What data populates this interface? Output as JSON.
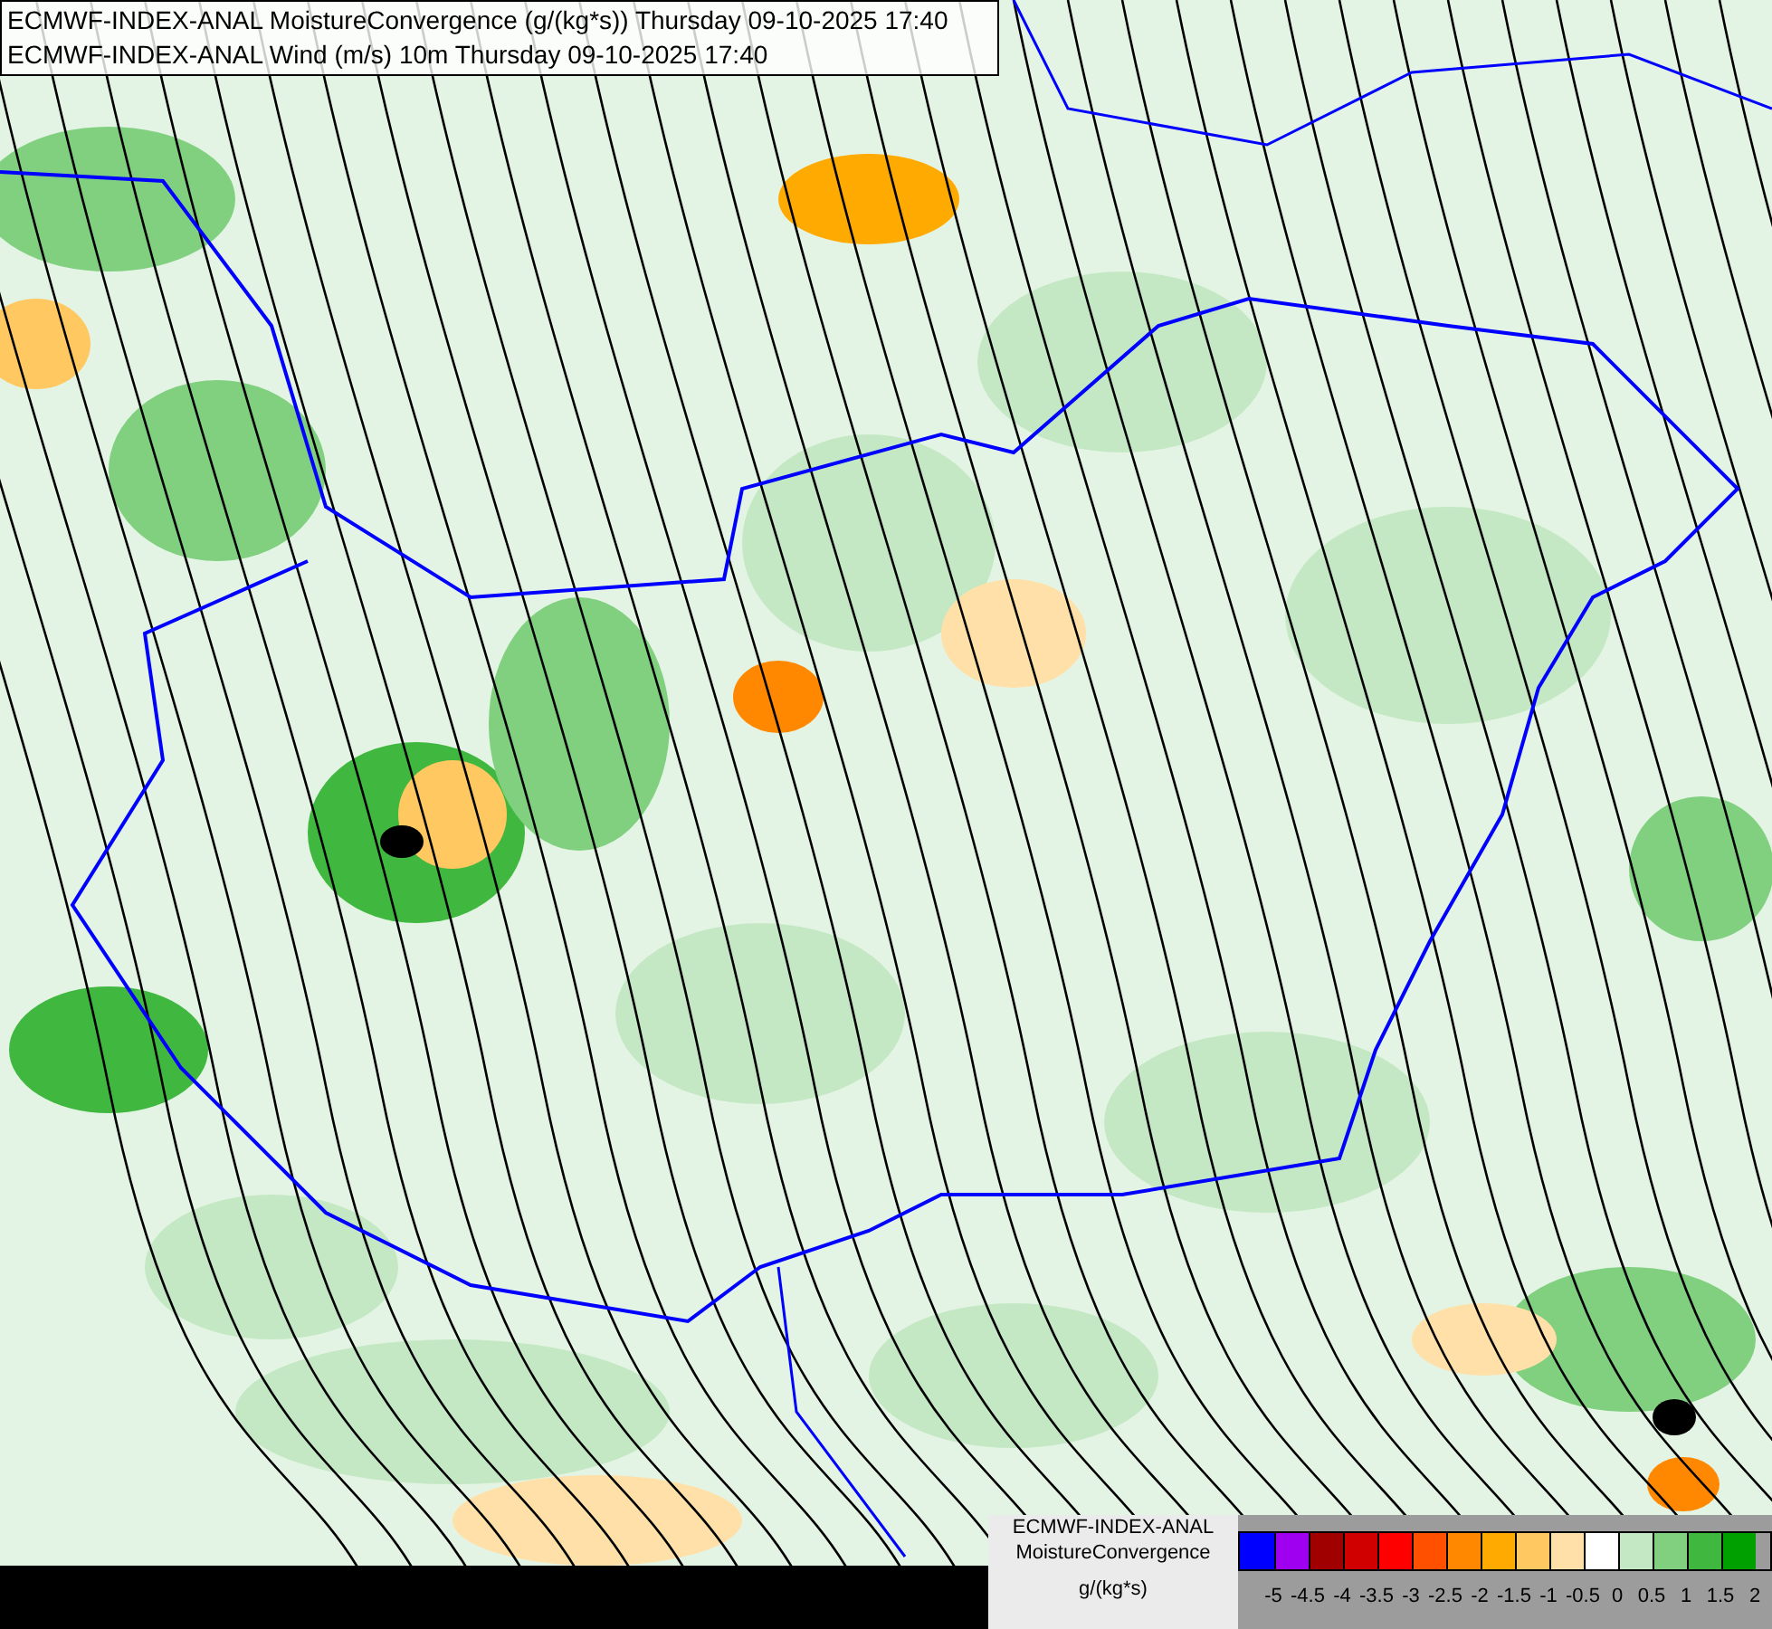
{
  "titles": [
    "ECMWF-INDEX-ANAL MoistureConvergence (g/(kg*s)) Thursday 09-10-2025 17:40",
    "ECMWF-INDEX-ANAL Wind (m/s) 10m Thursday 09-10-2025 17:40"
  ],
  "legend": {
    "title_lines": [
      "ECMWF-INDEX-ANAL",
      "MoistureConvergence"
    ],
    "unit": "g/(kg*s)",
    "bins": [
      {
        "color": "#0000ff"
      },
      {
        "color": "#a000f0"
      },
      {
        "color": "#a00000"
      },
      {
        "color": "#d00000"
      },
      {
        "color": "#ff0000"
      },
      {
        "color": "#ff5000"
      },
      {
        "color": "#ff8800"
      },
      {
        "color": "#ffaa00"
      },
      {
        "color": "#ffc860"
      },
      {
        "color": "#ffe0a8"
      },
      {
        "color": "#ffffff"
      },
      {
        "color": "#c4e8c4"
      },
      {
        "color": "#80d080"
      },
      {
        "color": "#40b840"
      },
      {
        "color": "#00a000"
      }
    ],
    "ticks": [
      "-5",
      "-4.5",
      "-4",
      "-3.5",
      "-3",
      "-2.5",
      "-2",
      "-1.5",
      "-1",
      "-0.5",
      "0",
      "0.5",
      "1",
      "1.5",
      "2"
    ]
  }
}
